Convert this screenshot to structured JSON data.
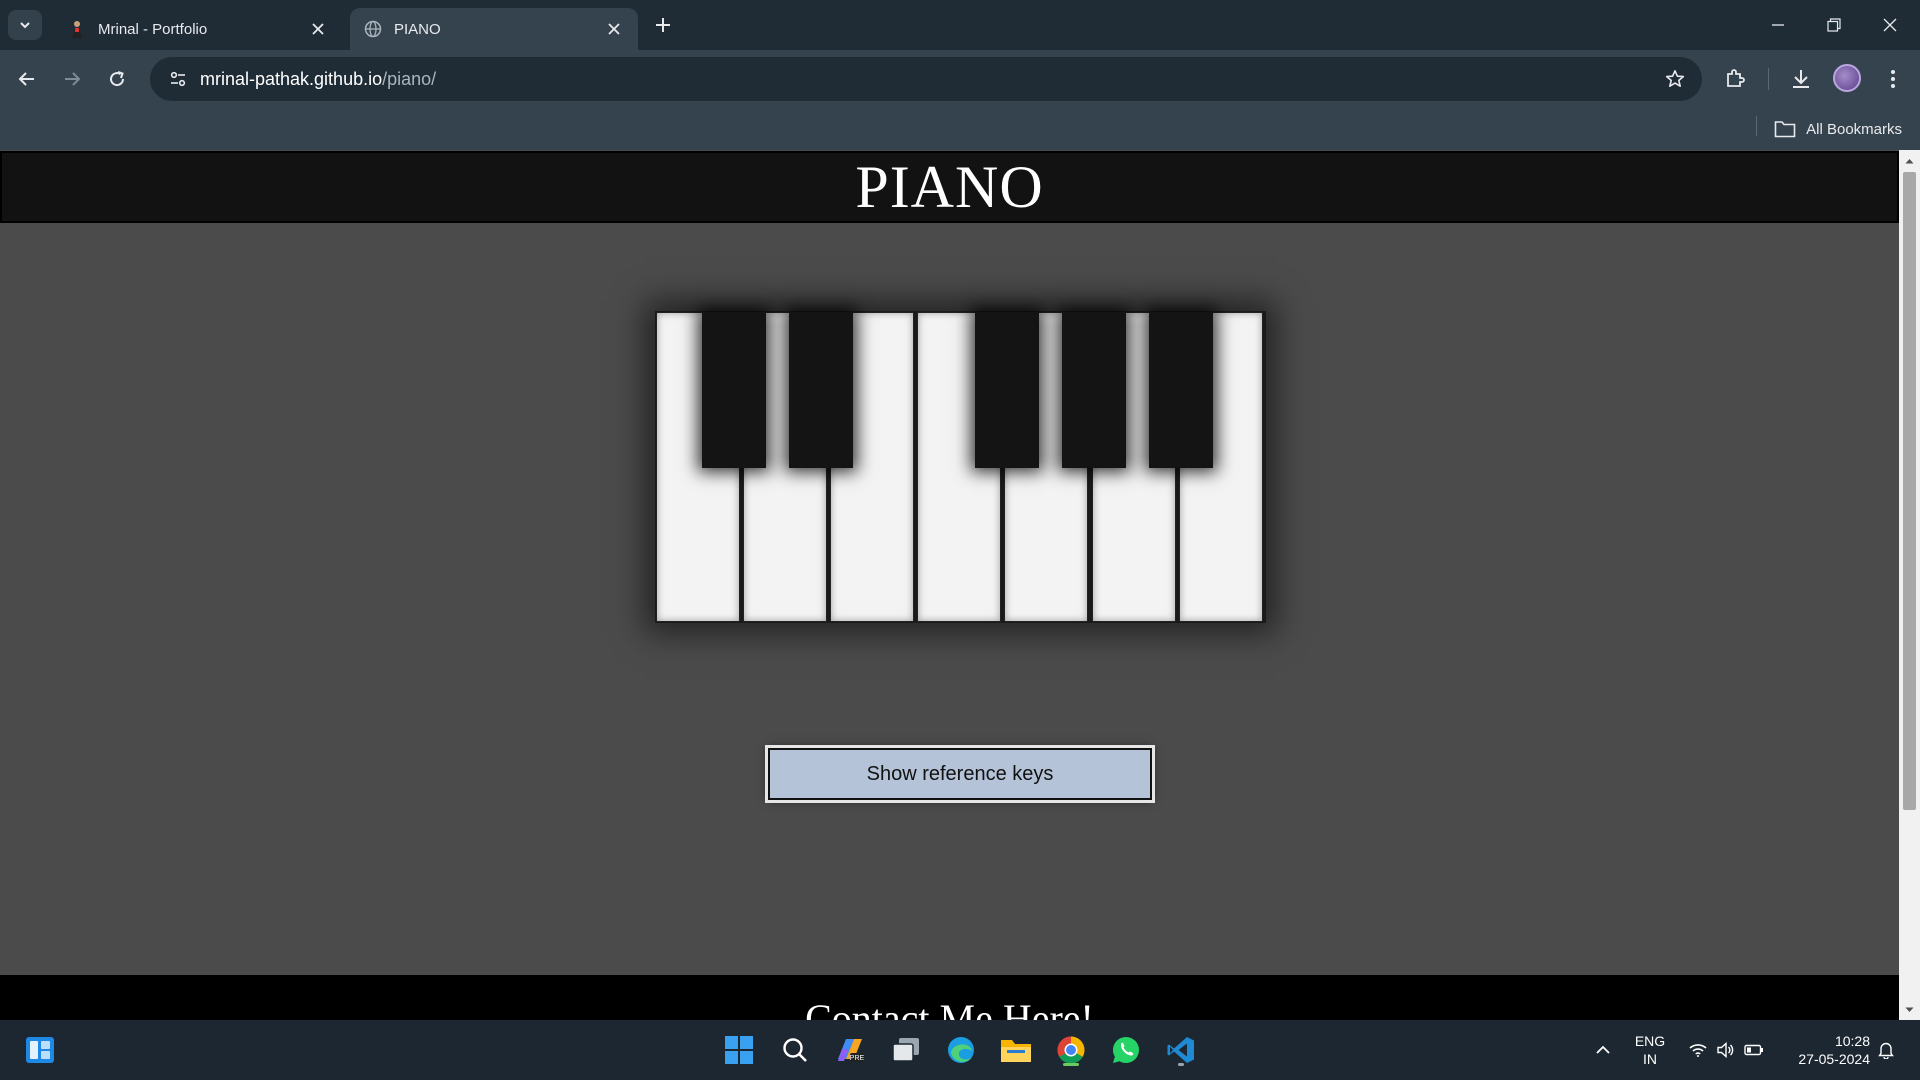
{
  "browser": {
    "tabs": [
      {
        "title": "Mrinal - Portfolio",
        "active": false
      },
      {
        "title": "PIANO",
        "active": true
      }
    ],
    "url_host": "mrinal-pathak.github.io",
    "url_path": "/piano/",
    "bookmarks_label": "All Bookmarks"
  },
  "page": {
    "title": "PIANO",
    "piano": {
      "white_keys": 7,
      "black_keys": 5
    },
    "reference_button": "Show reference keys",
    "footer_heading": "Contact Me Here!"
  },
  "taskbar": {
    "apps": [
      "start-icon",
      "search-icon",
      "copilot-icon",
      "task-view-icon",
      "edge-icon",
      "file-explorer-icon",
      "chrome-icon",
      "whatsapp-icon",
      "vscode-icon"
    ],
    "language_line1": "ENG",
    "language_line2": "IN",
    "time": "10:28",
    "date": "27-05-2024"
  },
  "colors": {
    "chrome_dark": "#1f2c36",
    "chrome": "#35434f",
    "page_bg": "#4b4b4b",
    "button_bg": "#b5c3d9"
  }
}
